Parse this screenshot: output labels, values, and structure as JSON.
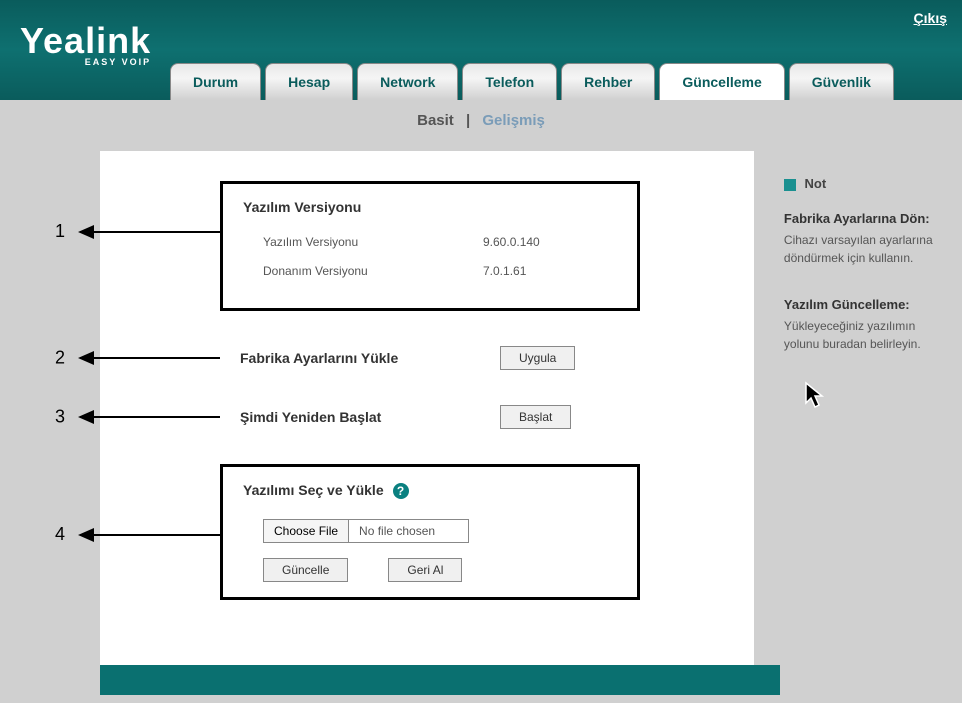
{
  "header": {
    "logout": "Çıkış",
    "logo": "Yealink",
    "logo_sub": "EASY VOIP"
  },
  "tabs": [
    {
      "label": "Durum"
    },
    {
      "label": "Hesap"
    },
    {
      "label": "Network"
    },
    {
      "label": "Telefon"
    },
    {
      "label": "Rehber"
    },
    {
      "label": "Güncelleme"
    },
    {
      "label": "Güvenlik"
    }
  ],
  "subnav": {
    "basic": "Basit",
    "advanced": "Gelişmiş"
  },
  "callouts": [
    "1",
    "2",
    "3",
    "4"
  ],
  "version_box": {
    "title": "Yazılım Versiyonu",
    "rows": [
      {
        "label": "Yazılım Versiyonu",
        "value": "9.60.0.140"
      },
      {
        "label": "Donanım Versiyonu",
        "value": "7.0.1.61"
      }
    ]
  },
  "factory_reset": {
    "label": "Fabrika Ayarlarını Yükle",
    "button": "Uygula"
  },
  "restart": {
    "label": "Şimdi Yeniden Başlat",
    "button": "Başlat"
  },
  "upload": {
    "title": "Yazılımı Seç ve Yükle",
    "choose_file": "Choose File",
    "no_file": "No file chosen",
    "update": "Güncelle",
    "revert": "Geri Al"
  },
  "sidebar": {
    "note_header": "Not",
    "sections": [
      {
        "title": "Fabrika Ayarlarına Dön:",
        "text": "Cihazı varsayılan ayarlarına döndürmek için kullanın."
      },
      {
        "title": "Yazılım Güncelleme:",
        "text": "Yükleyeceğiniz yazılımın yolunu buradan belirleyin."
      }
    ]
  }
}
